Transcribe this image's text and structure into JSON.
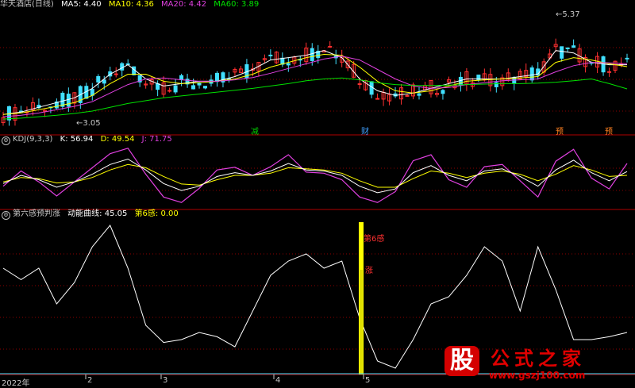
{
  "price_panel": {
    "title": "华天酒店(日线)",
    "ma": [
      {
        "label": "MA5: 4.40",
        "color": "#ffffff"
      },
      {
        "label": "MA10: 4.36",
        "color": "#ffff00"
      },
      {
        "label": "MA20: 4.42",
        "color": "#e040e0"
      },
      {
        "label": "MA60: 3.89",
        "color": "#00e000"
      }
    ],
    "high_label": "5.37",
    "low_label": "3.05",
    "events": [
      {
        "text": "减",
        "color": "#00cc00"
      },
      {
        "text": "财",
        "color": "#40a0ff"
      },
      {
        "text": "预",
        "color": "#ff8020"
      },
      {
        "text": "预",
        "color": "#ff8020"
      }
    ]
  },
  "kdj_panel": {
    "labels": [
      {
        "text": "KDJ(9,3,3)",
        "color": "#c8c8c8"
      },
      {
        "text": "K: 56.94",
        "color": "#ffffff"
      },
      {
        "text": "D: 49.54",
        "color": "#ffff00"
      },
      {
        "text": "J: 71.75",
        "color": "#e040e0"
      }
    ]
  },
  "sixth_panel": {
    "labels": [
      {
        "text": "第六感预判涨",
        "color": "#c8c8c8"
      },
      {
        "text": "动能曲线: 45.05",
        "color": "#ffffff"
      },
      {
        "text": "第6感: 0.00",
        "color": "#ffff00"
      }
    ],
    "signal_label_1": "第6感",
    "signal_label_2": "涨"
  },
  "x_axis": [
    "2022年",
    "2",
    "3",
    "4",
    "5"
  ],
  "watermark": {
    "logo_char": "股",
    "title": "公式之家",
    "url": "www.gszj100.com"
  },
  "colors": {
    "up": "#ff3030",
    "down": "#40e0ff",
    "ma5": "#ffffff",
    "ma10": "#ffff00",
    "ma20": "#e040e0",
    "ma60": "#00e000",
    "grid": "#8b0000",
    "border": "#b00000",
    "signal": "#ffff00"
  },
  "chart_data": {
    "type": "line",
    "title": "华天酒店(日线)",
    "xlabel": "",
    "ylabel": "",
    "categories": [
      "2022年",
      "2",
      "3",
      "4",
      "5"
    ],
    "price_hint": {
      "high": 5.37,
      "low": 3.05
    },
    "series": [
      {
        "name": "MA5",
        "values": [
          3.35,
          3.4,
          3.5,
          3.6,
          3.7,
          3.9,
          4.2,
          4.4,
          4.1,
          3.95,
          4.0,
          4.05,
          4.05,
          4.15,
          4.3,
          4.5,
          4.55,
          4.6,
          4.7,
          4.55,
          4.1,
          3.85,
          3.75,
          3.8,
          3.9,
          4.0,
          4.1,
          4.1,
          4.1,
          4.15,
          4.2,
          4.7,
          4.65,
          4.45,
          4.4,
          4.4
        ]
      },
      {
        "name": "MA10",
        "values": [
          3.35,
          3.38,
          3.45,
          3.52,
          3.6,
          3.75,
          4.0,
          4.2,
          4.2,
          4.05,
          4.0,
          4.02,
          4.05,
          4.1,
          4.2,
          4.35,
          4.45,
          4.55,
          4.62,
          4.6,
          4.35,
          4.05,
          3.85,
          3.8,
          3.85,
          3.95,
          4.05,
          4.08,
          4.1,
          4.12,
          4.15,
          4.45,
          4.55,
          4.5,
          4.42,
          4.36
        ]
      },
      {
        "name": "MA20",
        "values": [
          3.3,
          3.33,
          3.38,
          3.45,
          3.52,
          3.62,
          3.8,
          3.98,
          4.1,
          4.12,
          4.08,
          4.05,
          4.05,
          4.08,
          4.13,
          4.22,
          4.32,
          4.42,
          4.52,
          4.58,
          4.5,
          4.3,
          4.1,
          3.95,
          3.9,
          3.92,
          3.98,
          4.02,
          4.06,
          4.08,
          4.1,
          4.25,
          4.38,
          4.45,
          4.44,
          4.42
        ]
      },
      {
        "name": "MA60",
        "values": [
          3.25,
          3.27,
          3.3,
          3.33,
          3.37,
          3.42,
          3.5,
          3.58,
          3.64,
          3.7,
          3.74,
          3.78,
          3.82,
          3.86,
          3.9,
          3.95,
          4.0,
          4.06,
          4.1,
          4.12,
          4.08,
          4.02,
          3.98,
          3.96,
          3.96,
          3.97,
          3.98,
          3.99,
          4.0,
          4.0,
          4.01,
          4.03,
          4.06,
          4.1,
          4.0,
          3.89
        ]
      }
    ],
    "kdj": {
      "K": [
        35,
        50,
        42,
        28,
        38,
        52,
        70,
        80,
        60,
        35,
        22,
        30,
        48,
        55,
        50,
        58,
        72,
        60,
        58,
        50,
        30,
        18,
        25,
        55,
        68,
        50,
        40,
        58,
        62,
        48,
        30,
        60,
        78,
        55,
        40,
        57
      ],
      "D": [
        38,
        46,
        44,
        36,
        38,
        46,
        60,
        70,
        64,
        48,
        34,
        32,
        42,
        50,
        50,
        54,
        64,
        62,
        60,
        54,
        40,
        28,
        28,
        44,
        58,
        54,
        46,
        54,
        58,
        52,
        40,
        52,
        68,
        60,
        48,
        50
      ],
      "J": [
        30,
        58,
        38,
        12,
        38,
        64,
        90,
        100,
        52,
        10,
        0,
        26,
        60,
        65,
        50,
        66,
        88,
        56,
        54,
        42,
        10,
        0,
        20,
        77,
        88,
        42,
        28,
        66,
        70,
        40,
        10,
        76,
        98,
        45,
        25,
        72
      ]
    },
    "momentum": [
      70,
      62,
      70,
      45,
      60,
      85,
      100,
      70,
      30,
      18,
      20,
      25,
      22,
      15,
      40,
      65,
      75,
      80,
      70,
      75,
      35,
      5,
      0,
      20,
      45,
      50,
      65,
      85,
      75,
      40,
      85,
      55,
      20,
      20,
      22,
      25
    ],
    "sixth_sense_signal_index": 21
  }
}
